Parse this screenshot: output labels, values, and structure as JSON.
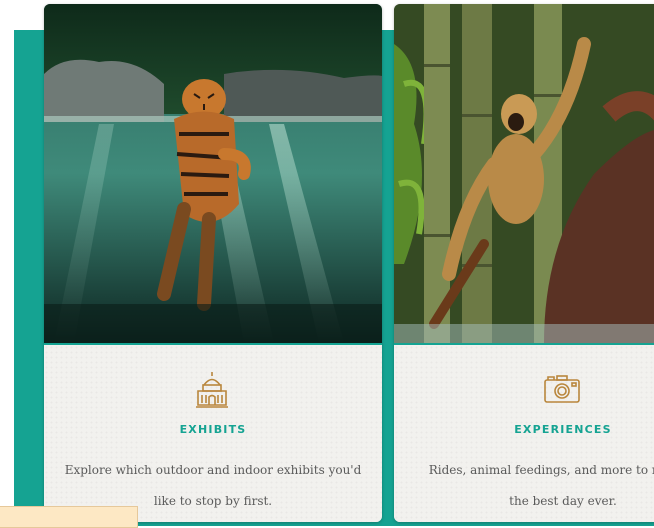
{
  "cards": [
    {
      "title": "EXHIBITS",
      "description": "Explore which outdoor and indoor exhibits you'd like to stop by first.",
      "icon": "building-icon",
      "photo": "tiger-swimming-photo"
    },
    {
      "title": "EXPERIENCES",
      "description": "Rides, animal feedings, and more to make it the best day ever.",
      "icon": "camera-icon",
      "photo": "gibbon-bamboo-photo"
    }
  ],
  "colors": {
    "accent": "#15a392",
    "card_bg": "#f2f1ee",
    "text": "#5a5a5a",
    "callout": "#fde8c4"
  }
}
